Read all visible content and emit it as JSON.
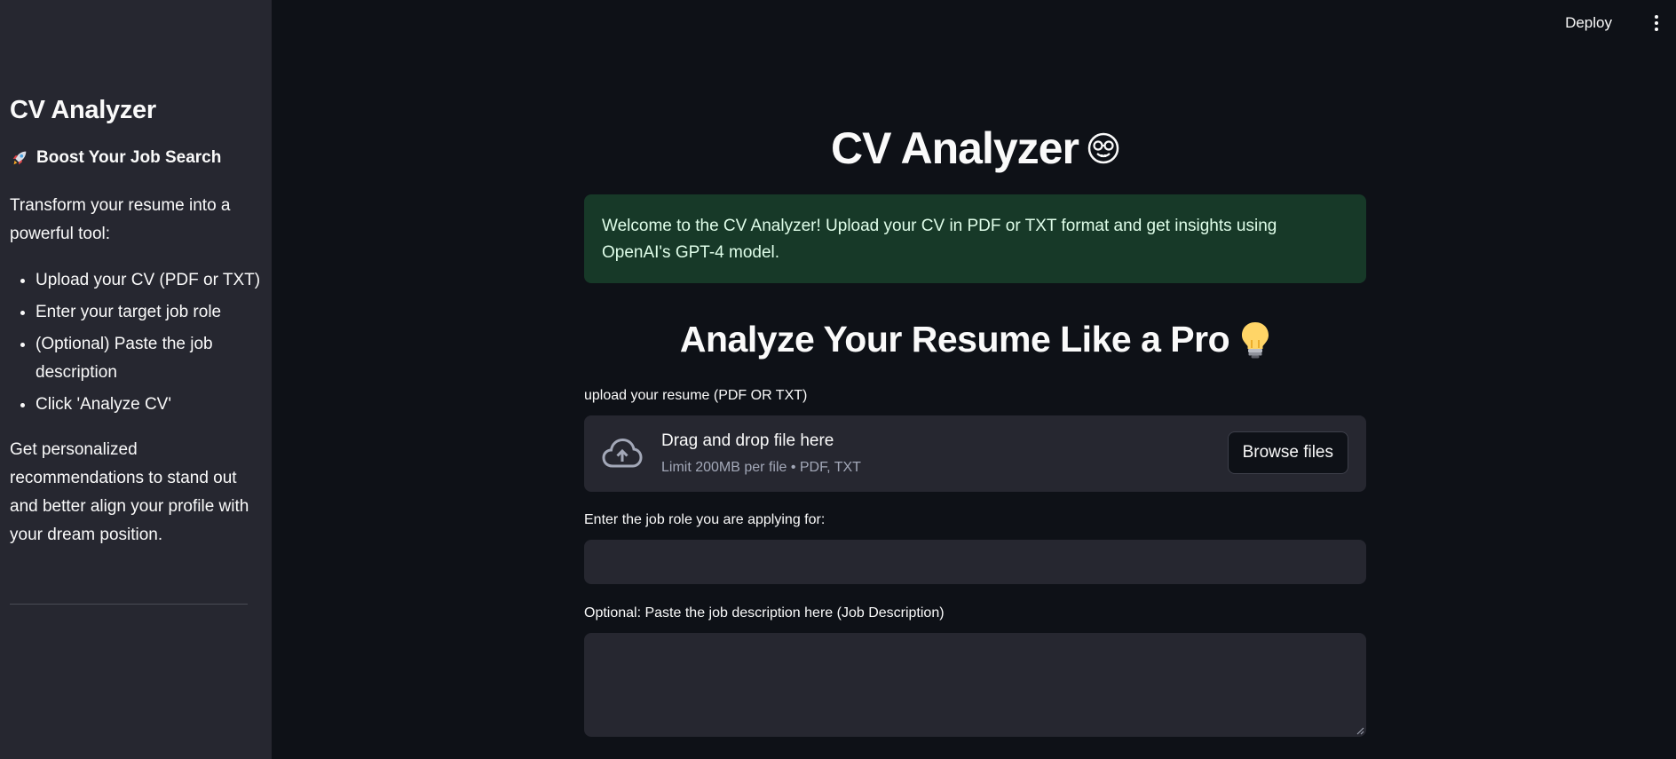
{
  "sidebar": {
    "title": "CV Analyzer",
    "subtitle": "Boost Your Job Search",
    "subtitle_icon": "rocket-icon",
    "intro": "Transform your resume into a powerful tool:",
    "steps": [
      "Upload your CV (PDF or TXT)",
      "Enter your target job role",
      "(Optional) Paste the job description",
      "Click 'Analyze CV'"
    ],
    "outro": "Get personalized recommendations to stand out and better align your profile with your dream position."
  },
  "header": {
    "deploy_label": "Deploy",
    "menu_icon": "vertical-dots-icon"
  },
  "main": {
    "title": "CV Analyzer",
    "title_icon": "nerd-face-icon",
    "info_message": "Welcome to the CV Analyzer! Upload your CV in PDF or TXT format and get insights using OpenAI's GPT-4 model.",
    "section_heading": "Analyze Your Resume Like a Pro",
    "section_icon": "light-bulb-icon",
    "upload": {
      "label": "upload your resume (PDF OR TXT)",
      "dropzone_title": "Drag and drop file here",
      "dropzone_hint": "Limit 200MB per file • PDF, TXT",
      "browse_label": "Browse files",
      "icon": "cloud-upload-icon"
    },
    "job_role": {
      "label": "Enter the job role you are applying for:",
      "value": ""
    },
    "job_description": {
      "label": "Optional: Paste the job description here (Job Description)",
      "value": ""
    }
  },
  "colors": {
    "background": "#0e1117",
    "sidebar": "#262730",
    "info_bg": "#173928",
    "info_text": "#dffde9",
    "text": "#fafafa"
  }
}
